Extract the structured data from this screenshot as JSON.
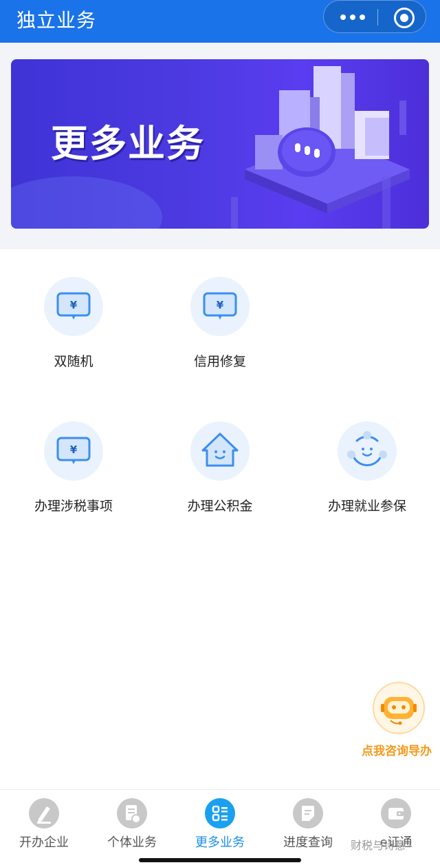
{
  "header": {
    "title": "独立业务"
  },
  "banner": {
    "title": "更多业务"
  },
  "grid": [
    {
      "label": "双随机",
      "icon": "yuan-message-icon"
    },
    {
      "label": "信用修复",
      "icon": "yuan-message-icon"
    },
    {
      "label": "办理涉税事项",
      "icon": "yuan-message-icon"
    },
    {
      "label": "办理公积金",
      "icon": "house-smile-icon"
    },
    {
      "label": "办理就业参保",
      "icon": "smile-dots-icon"
    }
  ],
  "helper": {
    "label": "点我咨询导办"
  },
  "tabs": [
    {
      "label": "开办企业",
      "icon": "pen-icon",
      "active": false
    },
    {
      "label": "个体业务",
      "icon": "document-icon",
      "active": false
    },
    {
      "label": "更多业务",
      "icon": "grid-icon",
      "active": true
    },
    {
      "label": "进度查询",
      "icon": "note-icon",
      "active": false
    },
    {
      "label": "e证通",
      "icon": "wallet-icon",
      "active": false
    }
  ],
  "watermark": "财税与诗意",
  "colors": {
    "primary": "#1a73e8",
    "tab_active": "#1a8fe6",
    "helper": "#f39a1c",
    "icon_blue": "#3a8ef0"
  }
}
